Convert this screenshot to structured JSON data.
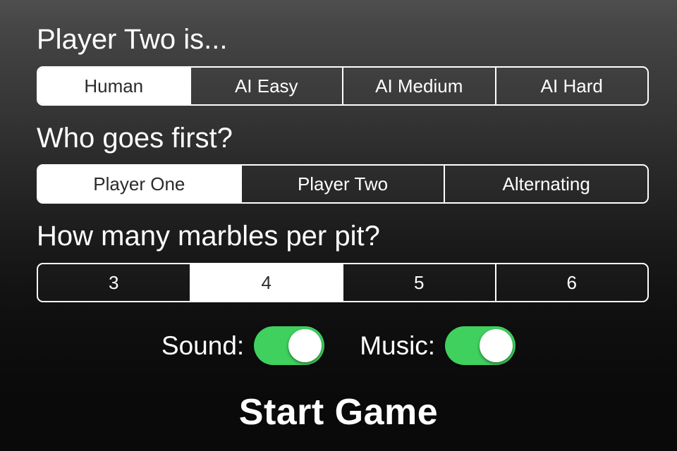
{
  "theme": {
    "accent_green": "#3fd05e",
    "selected_bg": "#ffffff",
    "selected_text": "#2a2a2a",
    "text": "#ffffff"
  },
  "settings": {
    "player_two": {
      "heading": "Player Two is...",
      "options": [
        "Human",
        "AI Easy",
        "AI Medium",
        "AI Hard"
      ],
      "selected_index": 0
    },
    "who_first": {
      "heading": "Who goes first?",
      "options": [
        "Player One",
        "Player Two",
        "Alternating"
      ],
      "selected_index": 0
    },
    "marbles": {
      "heading": "How many marbles per pit?",
      "options": [
        "3",
        "4",
        "5",
        "6"
      ],
      "selected_index": 1
    }
  },
  "toggles": [
    {
      "label": "Sound:",
      "state": "on"
    },
    {
      "label": "Music:",
      "state": "on"
    }
  ],
  "start": {
    "label": "Start Game"
  }
}
